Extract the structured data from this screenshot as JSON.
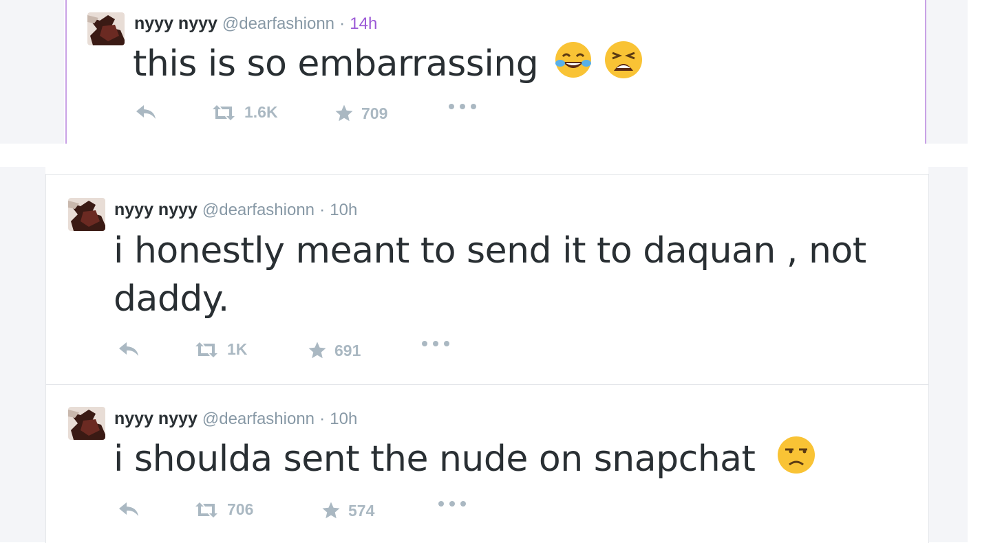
{
  "tweets": [
    {
      "name": "nyyy nyyy",
      "handle": "@dearfashionn",
      "separator": "·",
      "time": "14h",
      "text": "this is so embarrassing",
      "emojis": [
        "face-with-tears-of-joy-icon",
        "weary-face-icon"
      ],
      "retweets": "1.6K",
      "favorites": "709"
    },
    {
      "name": "nyyy nyyy",
      "handle": "@dearfashionn",
      "separator": "·",
      "time": "10h",
      "text_line1": "i honestly meant to send it to daquan , not",
      "text_line2": "daddy.",
      "retweets": "1K",
      "favorites": "691"
    },
    {
      "name": "nyyy nyyy",
      "handle": "@dearfashionn",
      "separator": "·",
      "time": "10h",
      "text": "i shoulda sent the nude on snapchat",
      "emojis": [
        "unamused-face-icon"
      ],
      "retweets": "706",
      "favorites": "574"
    }
  ],
  "colors": {
    "accent_border": "#c9a2e6",
    "muted": "#aab8c2",
    "text": "#292f33",
    "timestamp_active": "#9b59d6"
  }
}
